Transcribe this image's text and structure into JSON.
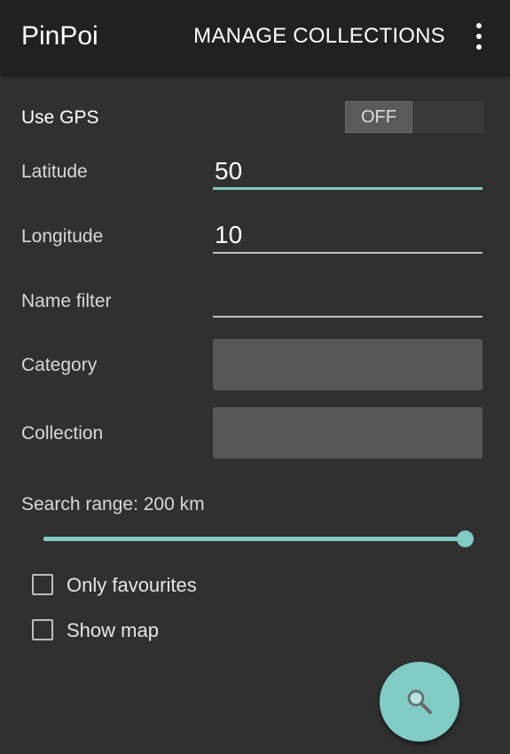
{
  "app_bar": {
    "title": "PinPoi",
    "manage_label": "MANAGE COLLECTIONS"
  },
  "form": {
    "gps_label": "Use GPS",
    "gps_toggle_text": "OFF",
    "latitude_label": "Latitude",
    "latitude_value": "50",
    "longitude_label": "Longitude",
    "longitude_value": "10",
    "name_filter_label": "Name filter",
    "name_filter_value": "",
    "category_label": "Category",
    "collection_label": "Collection",
    "search_range_label": "Search range: 200 km",
    "search_range_fraction": 1.0,
    "only_favourites_label": "Only favourites",
    "only_favourites_checked": false,
    "show_map_label": "Show map",
    "show_map_checked": false
  },
  "fab": {
    "icon": "search-icon"
  },
  "colors": {
    "accent": "#80cbc4",
    "background": "#303030",
    "app_bar": "#212121"
  }
}
